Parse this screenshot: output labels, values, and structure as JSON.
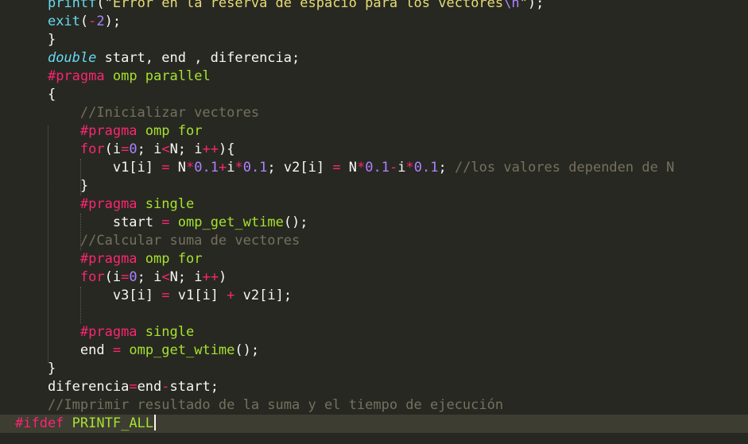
{
  "editor": {
    "theme_colors": {
      "background": "#272822",
      "current_line": "#3e3d32",
      "default": "#f8f8f2",
      "keyword": "#f92672",
      "function": "#66d9ef",
      "string": "#e6db74",
      "number": "#ae81ff",
      "comment": "#75715e",
      "directive": "#a6e22e"
    },
    "lines": [
      {
        "indent": "    ",
        "tokens": [
          [
            "func",
            "printf"
          ],
          [
            "var",
            "(\""
          ],
          [
            "str",
            "Error en la reserva de espacio para los vectores"
          ],
          [
            "esc",
            "\\n"
          ],
          [
            "str",
            "\""
          ],
          [
            "var",
            ");"
          ]
        ]
      },
      {
        "indent": "    ",
        "tokens": [
          [
            "func",
            "exit"
          ],
          [
            "var",
            "("
          ],
          [
            "op",
            "-"
          ],
          [
            "num",
            "2"
          ],
          [
            "var",
            ");"
          ]
        ]
      },
      {
        "indent": "    ",
        "tokens": [
          [
            "var",
            "}"
          ]
        ]
      },
      {
        "indent": "    ",
        "tokens": [
          [
            "type",
            "double"
          ],
          [
            "var",
            " start, end , diferencia;"
          ]
        ]
      },
      {
        "indent": "    ",
        "tokens": [
          [
            "pre",
            "#pragma"
          ],
          [
            "var",
            " "
          ],
          [
            "dir",
            "omp parallel"
          ]
        ]
      },
      {
        "indent": "    ",
        "tokens": [
          [
            "var",
            "{"
          ]
        ]
      },
      {
        "indent": "        ",
        "tokens": [
          [
            "cmt",
            "//Inicializar vectores"
          ]
        ]
      },
      {
        "indent": "        ",
        "tokens": [
          [
            "pre",
            "#pragma"
          ],
          [
            "var",
            " "
          ],
          [
            "dir",
            "omp for"
          ]
        ]
      },
      {
        "indent": "        ",
        "tokens": [
          [
            "kw",
            "for"
          ],
          [
            "var",
            "(i"
          ],
          [
            "op",
            "="
          ],
          [
            "num",
            "0"
          ],
          [
            "var",
            "; i"
          ],
          [
            "op",
            "<"
          ],
          [
            "var",
            "N; i"
          ],
          [
            "op",
            "++"
          ],
          [
            "var",
            "){"
          ]
        ]
      },
      {
        "indent": "            ",
        "tokens": [
          [
            "var",
            "v1[i] "
          ],
          [
            "op",
            "="
          ],
          [
            "var",
            " N"
          ],
          [
            "op",
            "*"
          ],
          [
            "num",
            "0.1"
          ],
          [
            "op",
            "+"
          ],
          [
            "var",
            "i"
          ],
          [
            "op",
            "*"
          ],
          [
            "num",
            "0.1"
          ],
          [
            "var",
            "; v2[i] "
          ],
          [
            "op",
            "="
          ],
          [
            "var",
            " N"
          ],
          [
            "op",
            "*"
          ],
          [
            "num",
            "0.1"
          ],
          [
            "op",
            "-"
          ],
          [
            "var",
            "i"
          ],
          [
            "op",
            "*"
          ],
          [
            "num",
            "0.1"
          ],
          [
            "var",
            "; "
          ],
          [
            "cmt",
            "//los valores dependen de N"
          ]
        ]
      },
      {
        "indent": "        ",
        "tokens": [
          [
            "var",
            "}"
          ]
        ]
      },
      {
        "indent": "        ",
        "tokens": [
          [
            "pre",
            "#pragma"
          ],
          [
            "var",
            " "
          ],
          [
            "dir",
            "single"
          ]
        ]
      },
      {
        "indent": "            ",
        "tokens": [
          [
            "var",
            "start "
          ],
          [
            "op",
            "="
          ],
          [
            "var",
            " "
          ],
          [
            "call",
            "omp_get_wtime"
          ],
          [
            "var",
            "();"
          ]
        ]
      },
      {
        "indent": "        ",
        "tokens": [
          [
            "cmt",
            "//Calcular suma de vectores"
          ]
        ]
      },
      {
        "indent": "        ",
        "tokens": [
          [
            "pre",
            "#pragma"
          ],
          [
            "var",
            " "
          ],
          [
            "dir",
            "omp for"
          ]
        ]
      },
      {
        "indent": "        ",
        "tokens": [
          [
            "kw",
            "for"
          ],
          [
            "var",
            "(i"
          ],
          [
            "op",
            "="
          ],
          [
            "num",
            "0"
          ],
          [
            "var",
            "; i"
          ],
          [
            "op",
            "<"
          ],
          [
            "var",
            "N; i"
          ],
          [
            "op",
            "++"
          ],
          [
            "var",
            ")"
          ]
        ]
      },
      {
        "indent": "            ",
        "tokens": [
          [
            "var",
            "v3[i] "
          ],
          [
            "op",
            "="
          ],
          [
            "var",
            " v1[i] "
          ],
          [
            "op",
            "+"
          ],
          [
            "var",
            " v2[i];"
          ]
        ]
      },
      {
        "indent": "",
        "tokens": []
      },
      {
        "indent": "        ",
        "tokens": [
          [
            "pre",
            "#pragma"
          ],
          [
            "var",
            " "
          ],
          [
            "dir",
            "single"
          ]
        ]
      },
      {
        "indent": "        ",
        "tokens": [
          [
            "var",
            "end "
          ],
          [
            "op",
            "="
          ],
          [
            "var",
            " "
          ],
          [
            "call",
            "omp_get_wtime"
          ],
          [
            "var",
            "();"
          ]
        ]
      },
      {
        "indent": "    ",
        "tokens": [
          [
            "var",
            "}"
          ]
        ]
      },
      {
        "indent": "    ",
        "tokens": [
          [
            "var",
            "diferencia"
          ],
          [
            "op",
            "="
          ],
          [
            "var",
            "end"
          ],
          [
            "op",
            "-"
          ],
          [
            "var",
            "start;"
          ]
        ]
      },
      {
        "indent": "    ",
        "tokens": [
          [
            "cmt",
            "//Imprimir resultado de la suma y el tiempo de ejecución"
          ]
        ]
      },
      {
        "indent": "",
        "tokens": [
          [
            "pre",
            "#ifdef"
          ],
          [
            "var",
            " "
          ],
          [
            "dir",
            "PRINTF_ALL"
          ]
        ],
        "current": true
      }
    ]
  }
}
